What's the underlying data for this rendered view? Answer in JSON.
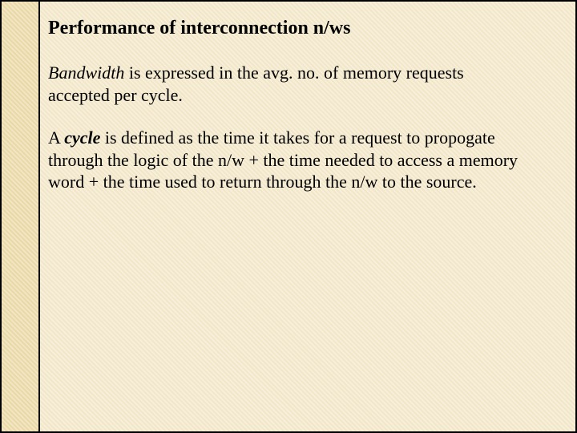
{
  "slide": {
    "title": "Performance of interconnection n/ws",
    "para1": {
      "term": "Bandwidth",
      "rest": " is expressed in the avg. no. of memory requests accepted per cycle."
    },
    "para2": {
      "lead": "A ",
      "term": "cycle",
      "rest": " is defined as the time it takes for a request to propogate through the logic of the n/w  + the time needed to access a memory word + the time used to return through the n/w to the source."
    }
  }
}
